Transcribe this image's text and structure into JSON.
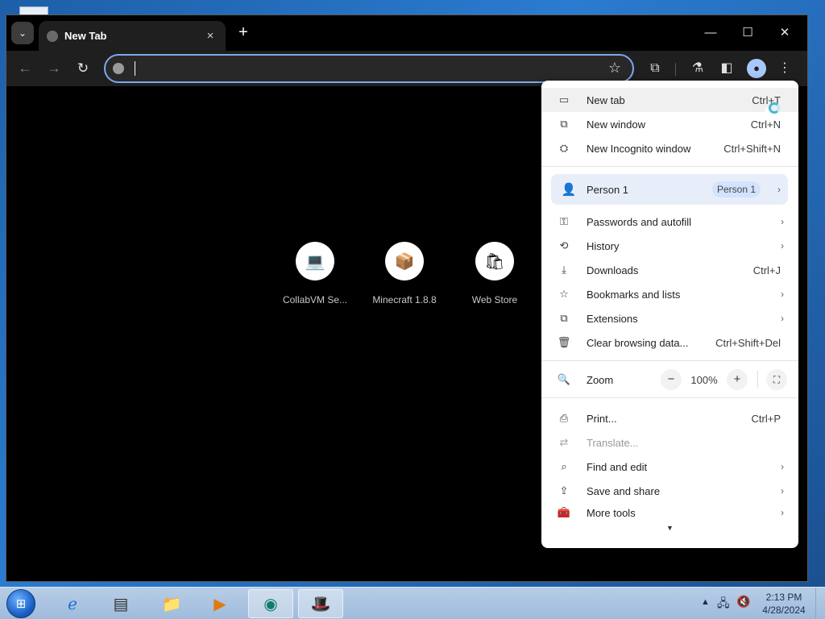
{
  "tab": {
    "title": "New Tab",
    "close": "×"
  },
  "titlebar": {
    "tab_search": "⌄",
    "new_tab": "+",
    "minimize": "—",
    "maximize": "☐",
    "close": "✕"
  },
  "toolbar": {
    "back": "←",
    "forward": "→",
    "reload": "↻",
    "star": "☆",
    "extensions": "⧉",
    "labs": "⚗",
    "side_panel": "◧",
    "profile": "●",
    "menu": "⋮"
  },
  "shortcuts": [
    {
      "label": "CollabVM Se...",
      "icon": "💻"
    },
    {
      "label": "Minecraft 1.8.8",
      "icon": "📦"
    },
    {
      "label": "Web Store",
      "icon": "🛍"
    }
  ],
  "menu": {
    "new_tab": {
      "label": "New tab",
      "shortcut": "Ctrl+T",
      "icon": "▭"
    },
    "new_window": {
      "label": "New window",
      "shortcut": "Ctrl+N",
      "icon": "⧉"
    },
    "incognito": {
      "label": "New Incognito window",
      "shortcut": "Ctrl+Shift+N",
      "icon": "⛭"
    },
    "person": {
      "label": "Person 1",
      "chip": "Person 1",
      "icon": "👤"
    },
    "passwords": {
      "label": "Passwords and autofill",
      "icon": "⚿"
    },
    "history": {
      "label": "History",
      "icon": "⟲"
    },
    "downloads": {
      "label": "Downloads",
      "shortcut": "Ctrl+J",
      "icon": "⤓"
    },
    "bookmarks": {
      "label": "Bookmarks and lists",
      "icon": "☆"
    },
    "extensions": {
      "label": "Extensions",
      "icon": "⧉"
    },
    "clear_data": {
      "label": "Clear browsing data...",
      "shortcut": "Ctrl+Shift+Del",
      "icon": "🗑"
    },
    "zoom": {
      "label": "Zoom",
      "value": "100%",
      "minus": "−",
      "plus": "+",
      "fullscreen": "⛶",
      "icon": "🔍"
    },
    "print": {
      "label": "Print...",
      "shortcut": "Ctrl+P",
      "icon": "⎙"
    },
    "translate": {
      "label": "Translate...",
      "icon": "⇄"
    },
    "find": {
      "label": "Find and edit",
      "icon": "⌕"
    },
    "save_share": {
      "label": "Save and share",
      "icon": "⇪"
    },
    "more_tools": {
      "label": "More tools",
      "icon": "🧰"
    },
    "arrow": "›",
    "scroll_down": "▼"
  },
  "taskbar": {
    "start": "⊞",
    "apps": [
      {
        "name": "ie",
        "icon": "ℯ"
      },
      {
        "name": "app-window",
        "icon": "▤"
      },
      {
        "name": "explorer",
        "icon": "📁"
      },
      {
        "name": "media-player",
        "icon": "▶"
      },
      {
        "name": "browser",
        "icon": "◉"
      },
      {
        "name": "hypercam",
        "icon": "🎩"
      }
    ],
    "tray": {
      "arrow": "▲",
      "network": "🖧",
      "volume": "🔇"
    },
    "time": "2:13 PM",
    "date": "4/28/2024"
  }
}
